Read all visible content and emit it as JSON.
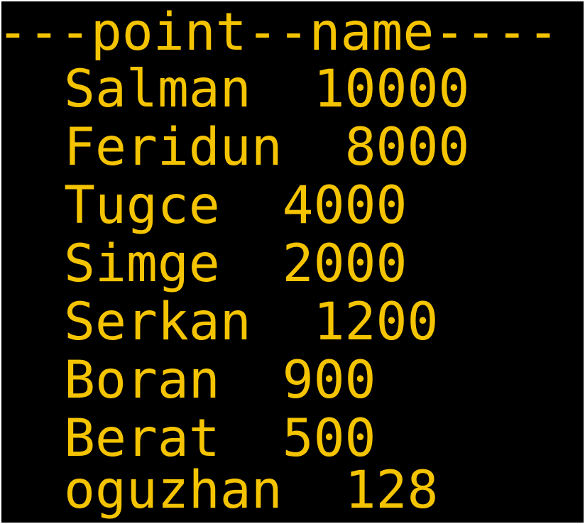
{
  "terminal": {
    "header": "---point--name----",
    "rows": [
      {
        "name": "Salman",
        "separator": "  ",
        "value": "10000"
      },
      {
        "name": "Feridun",
        "separator": "  ",
        "value": "8000"
      },
      {
        "name": "Tugce",
        "separator": "  ",
        "value": "4000"
      },
      {
        "name": "Simge",
        "separator": "  ",
        "value": "2000"
      },
      {
        "name": "Serkan",
        "separator": "  ",
        "value": "1200"
      },
      {
        "name": "Boran",
        "separator": "  ",
        "value": "900"
      },
      {
        "name": "Berat",
        "separator": "  ",
        "value": "500"
      },
      {
        "name": "oguzhan",
        "separator": "  ",
        "value": "128"
      }
    ],
    "colors": {
      "background": "#000000",
      "text": "#f5c400"
    }
  }
}
